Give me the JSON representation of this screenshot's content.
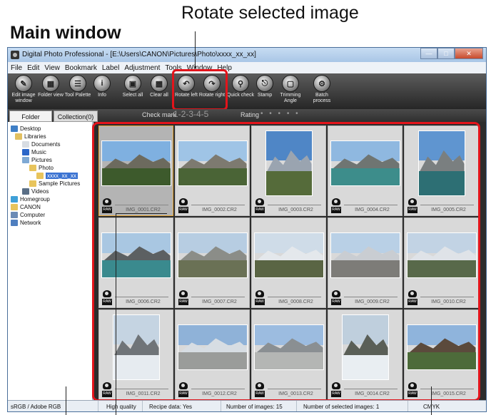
{
  "annotations": {
    "rotate_caption": "Rotate selected image",
    "window_caption": "Main window"
  },
  "window": {
    "title": "Digital Photo Professional - [E:\\Users\\CANON\\Pictures\\Photo\\xxxx_xx_xx]"
  },
  "menu": [
    "File",
    "Edit",
    "View",
    "Bookmark",
    "Label",
    "Adjustment",
    "Tools",
    "Window",
    "Help"
  ],
  "toolbar": {
    "edit_image_window": "Edit image window",
    "folder_view": "Folder view",
    "tool_palette": "Tool Palette",
    "info": "Info",
    "select_all": "Select all",
    "clear_all": "Clear all",
    "rotate_left": "Rotate left",
    "rotate_right": "Rotate right",
    "quick_check": "Quick check",
    "stamp": "Stamp",
    "trimming_angle": "Trimming Angle",
    "batch_process": "Batch process"
  },
  "tabs": {
    "folder": "Folder",
    "collection": "Collection(0)",
    "check_mark_label": "Check mark",
    "check_mark_values": "-1-2-3-4-5",
    "rating_label": "Rating",
    "rating_dots": "• • • • •"
  },
  "tree": {
    "desktop": "Desktop",
    "libraries": "Libraries",
    "documents": "Documents",
    "music": "Music",
    "pictures": "Pictures",
    "photo": "Photo",
    "selected_folder": "xxxx_xx_xx",
    "sample_pictures": "Sample Pictures",
    "videos": "Videos",
    "homegroup": "Homegroup",
    "canon": "CANON",
    "computer": "Computer",
    "network": "Network"
  },
  "images": [
    {
      "name": "IMG_0001.CR2",
      "raw_label": "RAW",
      "orientation": "landscape",
      "selected": true,
      "sky": "#7fb0e0",
      "mount": "#6c6a5e",
      "ground": "#3d5a2c"
    },
    {
      "name": "IMG_0002.CR2",
      "raw_label": "RAW",
      "orientation": "landscape",
      "selected": false,
      "sky": "#9fc4e6",
      "mount": "#7d7a70",
      "ground": "#4a6436"
    },
    {
      "name": "IMG_0003.CR2",
      "raw_label": "RAW",
      "orientation": "portrait",
      "selected": false,
      "sky": "#4f86c6",
      "mount": "#9aa4b0",
      "ground": "#556b3a"
    },
    {
      "name": "IMG_0004.CR2",
      "raw_label": "RAW",
      "orientation": "landscape",
      "selected": false,
      "sky": "#8fb8e0",
      "mount": "#6f7572",
      "ground": "#3d8d8b"
    },
    {
      "name": "IMG_0005.CR2",
      "raw_label": "RAW",
      "orientation": "portrait",
      "selected": false,
      "sky": "#5f95d0",
      "mount": "#7a7f80",
      "ground": "#2d6f74"
    },
    {
      "name": "IMG_0006.CR2",
      "raw_label": "RAW",
      "orientation": "landscape",
      "selected": false,
      "sky": "#a9c7e2",
      "mount": "#5c6062",
      "ground": "#3a8a8e"
    },
    {
      "name": "IMG_0007.CR2",
      "raw_label": "RAW",
      "orientation": "landscape",
      "selected": false,
      "sky": "#b7cde2",
      "mount": "#8b8d88",
      "ground": "#6a7155"
    },
    {
      "name": "IMG_0008.CR2",
      "raw_label": "RAW",
      "orientation": "landscape",
      "selected": false,
      "sky": "#cfdce8",
      "mount": "#e4e8ec",
      "ground": "#5a6544"
    },
    {
      "name": "IMG_0009.CR2",
      "raw_label": "RAW",
      "orientation": "landscape",
      "selected": false,
      "sky": "#b9d0e6",
      "mount": "#c9cdd2",
      "ground": "#7d7c78"
    },
    {
      "name": "IMG_0010.CR2",
      "raw_label": "RAW",
      "orientation": "landscape",
      "selected": false,
      "sky": "#c2d3e4",
      "mount": "#dfe3e8",
      "ground": "#58694a"
    },
    {
      "name": "IMG_0011.CR2",
      "raw_label": "RAW",
      "orientation": "portrait",
      "selected": false,
      "sky": "#c5d4e2",
      "mount": "#6f7478",
      "ground": "#e6ebf0"
    },
    {
      "name": "IMG_0012.CR2",
      "raw_label": "RAW",
      "orientation": "landscape",
      "selected": false,
      "sky": "#8fb2d8",
      "mount": "#d7dde3",
      "ground": "#9a9c9a"
    },
    {
      "name": "IMG_0013.CR2",
      "raw_label": "RAW",
      "orientation": "landscape",
      "selected": false,
      "sky": "#9cbce0",
      "mount": "#8a8f92",
      "ground": "#b4b6b4"
    },
    {
      "name": "IMG_0014.CR2",
      "raw_label": "RAW",
      "orientation": "portrait",
      "selected": false,
      "sky": "#bfcfdd",
      "mount": "#5a5f57",
      "ground": "#e9eef2"
    },
    {
      "name": "IMG_0015.CR2",
      "raw_label": "RAW",
      "orientation": "landscape",
      "selected": false,
      "sky": "#8fb4dc",
      "mount": "#5b4a3c",
      "ground": "#4d6b3a"
    }
  ],
  "status": {
    "color_space": "sRGB / Adobe RGB",
    "quality": "High quality",
    "recipe": "Recipe data: Yes",
    "num_images": "Number of images: 15",
    "num_selected": "Number of selected images: 1",
    "cmyk": "CMYK"
  },
  "colors": {
    "highlight": "#e3141b",
    "toolbar_bg": "#3a3a3a",
    "selection": "#3b73d2"
  }
}
